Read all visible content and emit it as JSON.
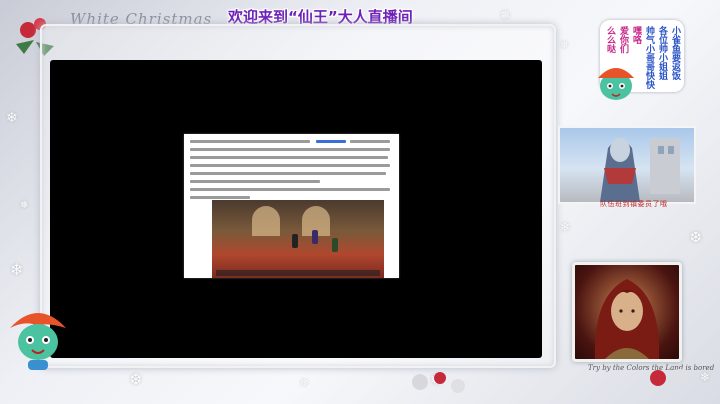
{
  "header": {
    "brand": "White Christmas",
    "title": "欢迎来到“仙王”大人直播间"
  },
  "speech_bubble": {
    "columns": [
      {
        "text": "小雀鱼要返饭",
        "color": "#2a54c8"
      },
      {
        "text": "各位帅小姐姐",
        "color": "#2a54c8"
      },
      {
        "text": "帅气小哥哥快快",
        "color": "#2a54c8"
      },
      {
        "text": "嘿咯",
        "color": "#c8288a"
      },
      {
        "text": "爱你们",
        "color": "#c8288a"
      },
      {
        "text": "么么哒",
        "color": "#c8288a"
      }
    ]
  },
  "side_panel": {
    "anime_caption": "队伍班到镇委员了哦",
    "portrait_signature": "Try by the Colors the Land is bored"
  },
  "colors": {
    "title": "#6e1fb8",
    "video_bg": "#000000",
    "caption": "#c02a2a"
  },
  "icons": [
    "snowflake-icon",
    "christmas-ornament-icon",
    "mascot-fish-icon"
  ]
}
